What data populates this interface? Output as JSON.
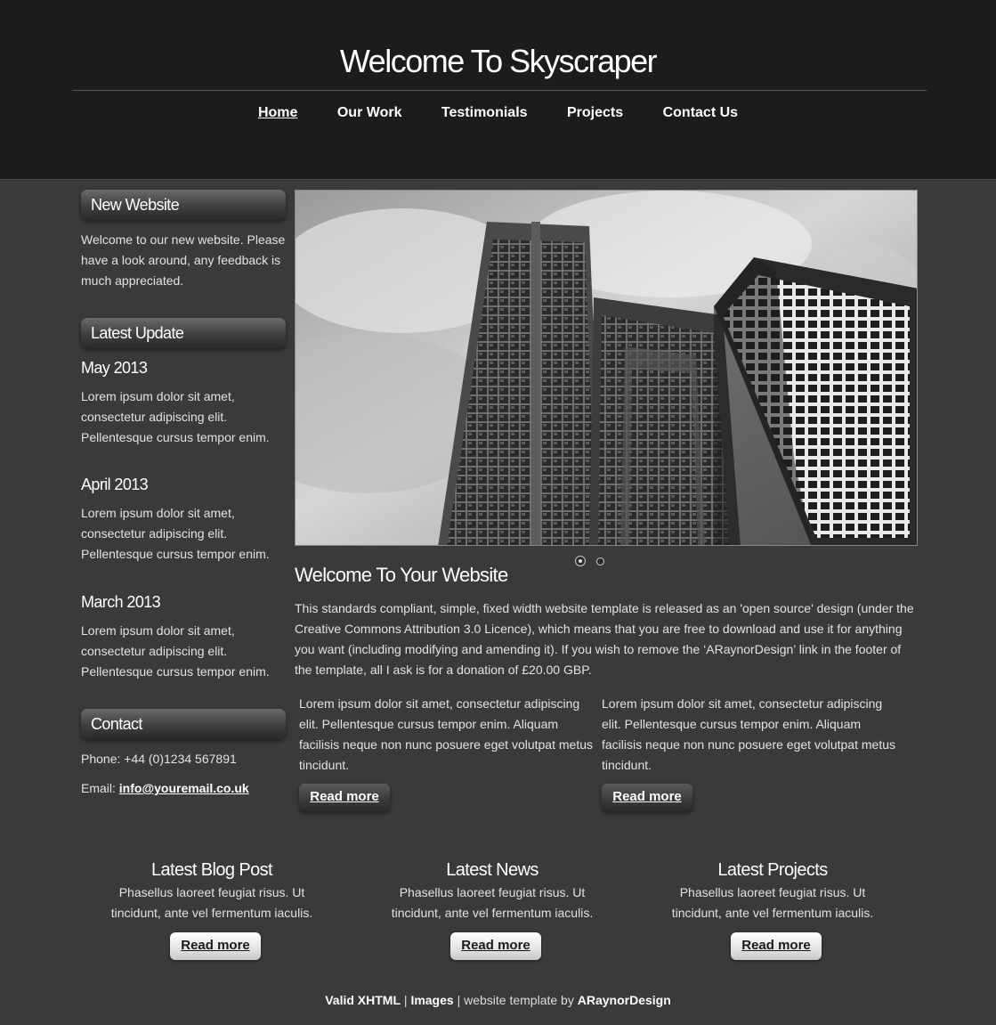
{
  "header": {
    "title": "Welcome To Skyscraper",
    "nav": [
      "Home",
      "Our Work",
      "Testimonials",
      "Projects",
      "Contact Us"
    ],
    "selected": "Home"
  },
  "sidebar": {
    "new_website": {
      "heading": "New Website",
      "text": "Welcome to our new website. Please have a look around, any feedback is much appreciated."
    },
    "latest_update": {
      "heading": "Latest Update",
      "items": [
        {
          "date": "May 2013",
          "text": "Lorem ipsum dolor sit amet, consectetur adipiscing elit. Pellentesque cursus tempor enim."
        },
        {
          "date": "April 2013",
          "text": "Lorem ipsum dolor sit amet, consectetur adipiscing elit. Pellentesque cursus tempor enim."
        },
        {
          "date": "March 2013",
          "text": "Lorem ipsum dolor sit amet, consectetur adipiscing elit. Pellentesque cursus tempor enim."
        }
      ]
    },
    "contact": {
      "heading": "Contact",
      "phone": "Phone: +44 (0)1234 567891",
      "email_label": "Email: ",
      "email": "info@youremail.co.uk"
    }
  },
  "main": {
    "heading": "Welcome To Your Website",
    "intro": "This standards compliant, simple, fixed width website template is released as an 'open source' design (under the Creative Commons Attribution 3.0 Licence), which means that you are free to download and use it for anything you want (including modifying and amending it). If you wish to remove the ‘ARaynorDesign’ link in the footer of the template, all I ask is for a donation of £20.00 GBP.",
    "columns": [
      {
        "text": "Lorem ipsum dolor sit amet, consectetur adipiscing elit. Pellentesque cursus tempor enim. Aliquam facilisis neque non nunc posuere eget volutpat metus tincidunt.",
        "button": "Read more"
      },
      {
        "text": "Lorem ipsum dolor sit amet, consectetur adipiscing elit. Pellentesque cursus tempor enim. Aliquam facilisis neque non nunc posuere eget volutpat metus tincidunt.",
        "button": "Read more"
      }
    ],
    "slideshow": {
      "slides": 2,
      "active": 1
    }
  },
  "bottom": [
    {
      "heading": "Latest Blog Post",
      "text": "Phasellus laoreet feugiat risus. Ut tincidunt, ante vel fermentum iaculis.",
      "button": "Read more"
    },
    {
      "heading": "Latest News",
      "text": "Phasellus laoreet feugiat risus. Ut tincidunt, ante vel fermentum iaculis.",
      "button": "Read more"
    },
    {
      "heading": "Latest Projects",
      "text": "Phasellus laoreet feugiat risus. Ut tincidunt, ante vel fermentum iaculis.",
      "button": "Read more"
    }
  ],
  "footer": {
    "valid": "Valid XHTML",
    "sep": " | ",
    "images": "Images",
    "by": " | website template by ",
    "author": "ARaynorDesign"
  },
  "colors": {
    "header_bg": "#1c1c1c",
    "page_bg": "#3a3a3a"
  }
}
